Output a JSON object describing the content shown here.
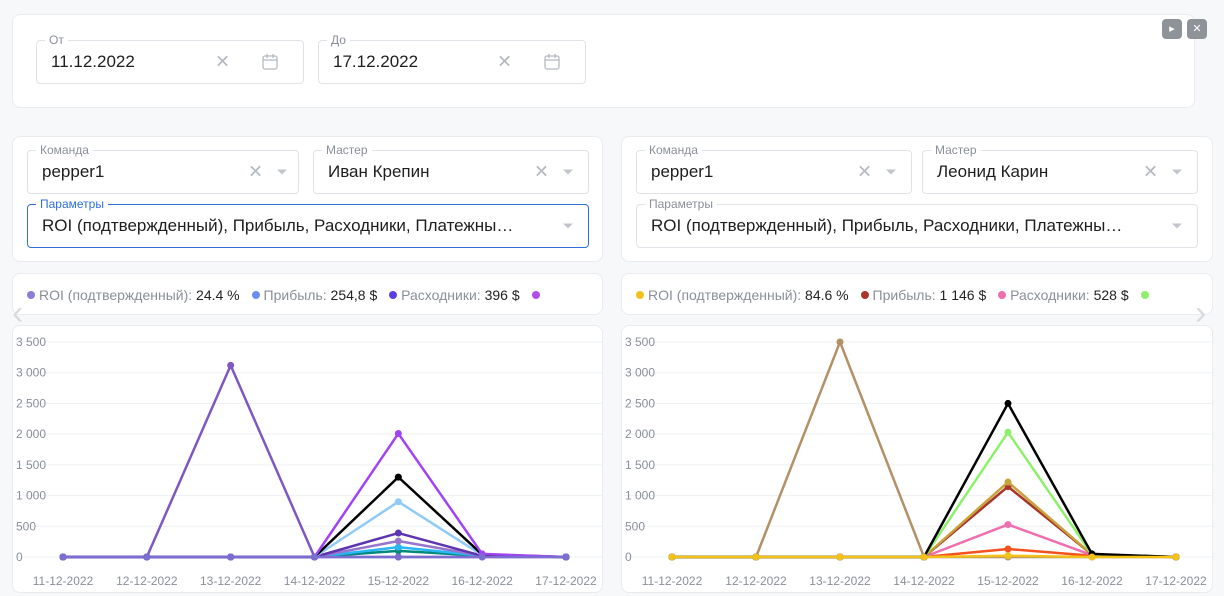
{
  "date_range": {
    "from": {
      "label": "От",
      "value": "11.12.2022"
    },
    "to": {
      "label": "До",
      "value": "17.12.2022"
    }
  },
  "top_buttons": {
    "play_glyph": "▸",
    "close_glyph": "✕"
  },
  "nav": {
    "prev_glyph": "‹",
    "next_glyph": "›"
  },
  "panels": [
    {
      "team": {
        "label": "Команда",
        "value": "pepper1"
      },
      "master": {
        "label": "Мастер",
        "value": "Иван Крепин"
      },
      "params": {
        "label": "Параметры",
        "value": "ROI (подтвержденный), Прибыль, Расходники, Платежны…"
      },
      "legend": [
        {
          "name": "ROI (подтвержденный):",
          "value": "24.4 %",
          "color": "#8a7fd6"
        },
        {
          "name": "Прибыль:",
          "value": "254,8 $",
          "color": "#6a8ef0"
        },
        {
          "name": "Расходники:",
          "value": "396 $",
          "color": "#5b3fe0"
        },
        {
          "name": "",
          "value": "",
          "color": "#b44dea"
        }
      ]
    },
    {
      "team": {
        "label": "Команда",
        "value": "pepper1"
      },
      "master": {
        "label": "Мастер",
        "value": "Леонид Карин"
      },
      "params": {
        "label": "Параметры",
        "value": "ROI (подтвержденный), Прибыль, Расходники, Платежны…"
      },
      "legend": [
        {
          "name": "ROI (подтвержденный):",
          "value": "84.6 %",
          "color": "#f2c21a"
        },
        {
          "name": "Прибыль:",
          "value": "1 146 $",
          "color": "#a8352a"
        },
        {
          "name": "Расходники:",
          "value": "528 $",
          "color": "#ef6fae"
        },
        {
          "name": "",
          "value": "",
          "color": "#8ef06a"
        }
      ]
    }
  ],
  "chart_data": [
    {
      "type": "line",
      "categories": [
        "11-12-2022",
        "12-12-2022",
        "13-12-2022",
        "14-12-2022",
        "15-12-2022",
        "16-12-2022",
        "17-12-2022"
      ],
      "ylim": [
        0,
        3500
      ],
      "yticks": [
        "0",
        "500",
        "1 000",
        "1 500",
        "2 000",
        "2 500",
        "3 000",
        "3 500"
      ],
      "grid": true,
      "series": [
        {
          "color": "#7e57c2",
          "values": [
            0,
            0,
            3120,
            0,
            0,
            0,
            0
          ]
        },
        {
          "color": "#00897b",
          "values": [
            0,
            0,
            0,
            0,
            100,
            20,
            0
          ]
        },
        {
          "color": "#29b6f6",
          "values": [
            0,
            0,
            0,
            0,
            160,
            20,
            0
          ]
        },
        {
          "color": "#9575cd",
          "values": [
            0,
            0,
            0,
            0,
            260,
            20,
            0
          ]
        },
        {
          "color": "#5e35b1",
          "values": [
            0,
            0,
            0,
            0,
            390,
            20,
            0
          ]
        },
        {
          "color": "#90caf9",
          "values": [
            0,
            0,
            0,
            0,
            900,
            30,
            0
          ]
        },
        {
          "color": "#000000",
          "values": [
            0,
            0,
            0,
            0,
            1300,
            40,
            0
          ]
        },
        {
          "color": "#a142f4",
          "values": [
            0,
            0,
            0,
            0,
            2010,
            50,
            0
          ]
        },
        {
          "color": "#7a6fd0",
          "values": [
            0,
            0,
            0,
            0,
            0,
            0,
            0
          ]
        }
      ]
    },
    {
      "type": "line",
      "categories": [
        "11-12-2022",
        "12-12-2022",
        "13-12-2022",
        "14-12-2022",
        "15-12-2022",
        "16-12-2022",
        "17-12-2022"
      ],
      "ylim": [
        0,
        3500
      ],
      "yticks": [
        "0",
        "500",
        "1 000",
        "1 500",
        "2 000",
        "2 500",
        "3 000",
        "3 500"
      ],
      "grid": true,
      "series": [
        {
          "color": "#b39066",
          "values": [
            0,
            0,
            3500,
            0,
            0,
            0,
            0
          ]
        },
        {
          "color": "#f4511e",
          "values": [
            0,
            0,
            0,
            0,
            130,
            20,
            0
          ]
        },
        {
          "color": "#ef6fae",
          "values": [
            0,
            0,
            0,
            0,
            528,
            30,
            0
          ]
        },
        {
          "color": "#a8352a",
          "values": [
            0,
            0,
            0,
            0,
            1146,
            40,
            0
          ]
        },
        {
          "color": "#c8a23a",
          "values": [
            0,
            0,
            0,
            0,
            1220,
            40,
            0
          ]
        },
        {
          "color": "#8ef06a",
          "values": [
            0,
            0,
            0,
            0,
            2030,
            40,
            0
          ]
        },
        {
          "color": "#000000",
          "values": [
            0,
            0,
            0,
            0,
            2500,
            50,
            0
          ]
        },
        {
          "color": "#f2c21a",
          "values": [
            0,
            0,
            0,
            0,
            20,
            0,
            0
          ]
        }
      ]
    }
  ]
}
